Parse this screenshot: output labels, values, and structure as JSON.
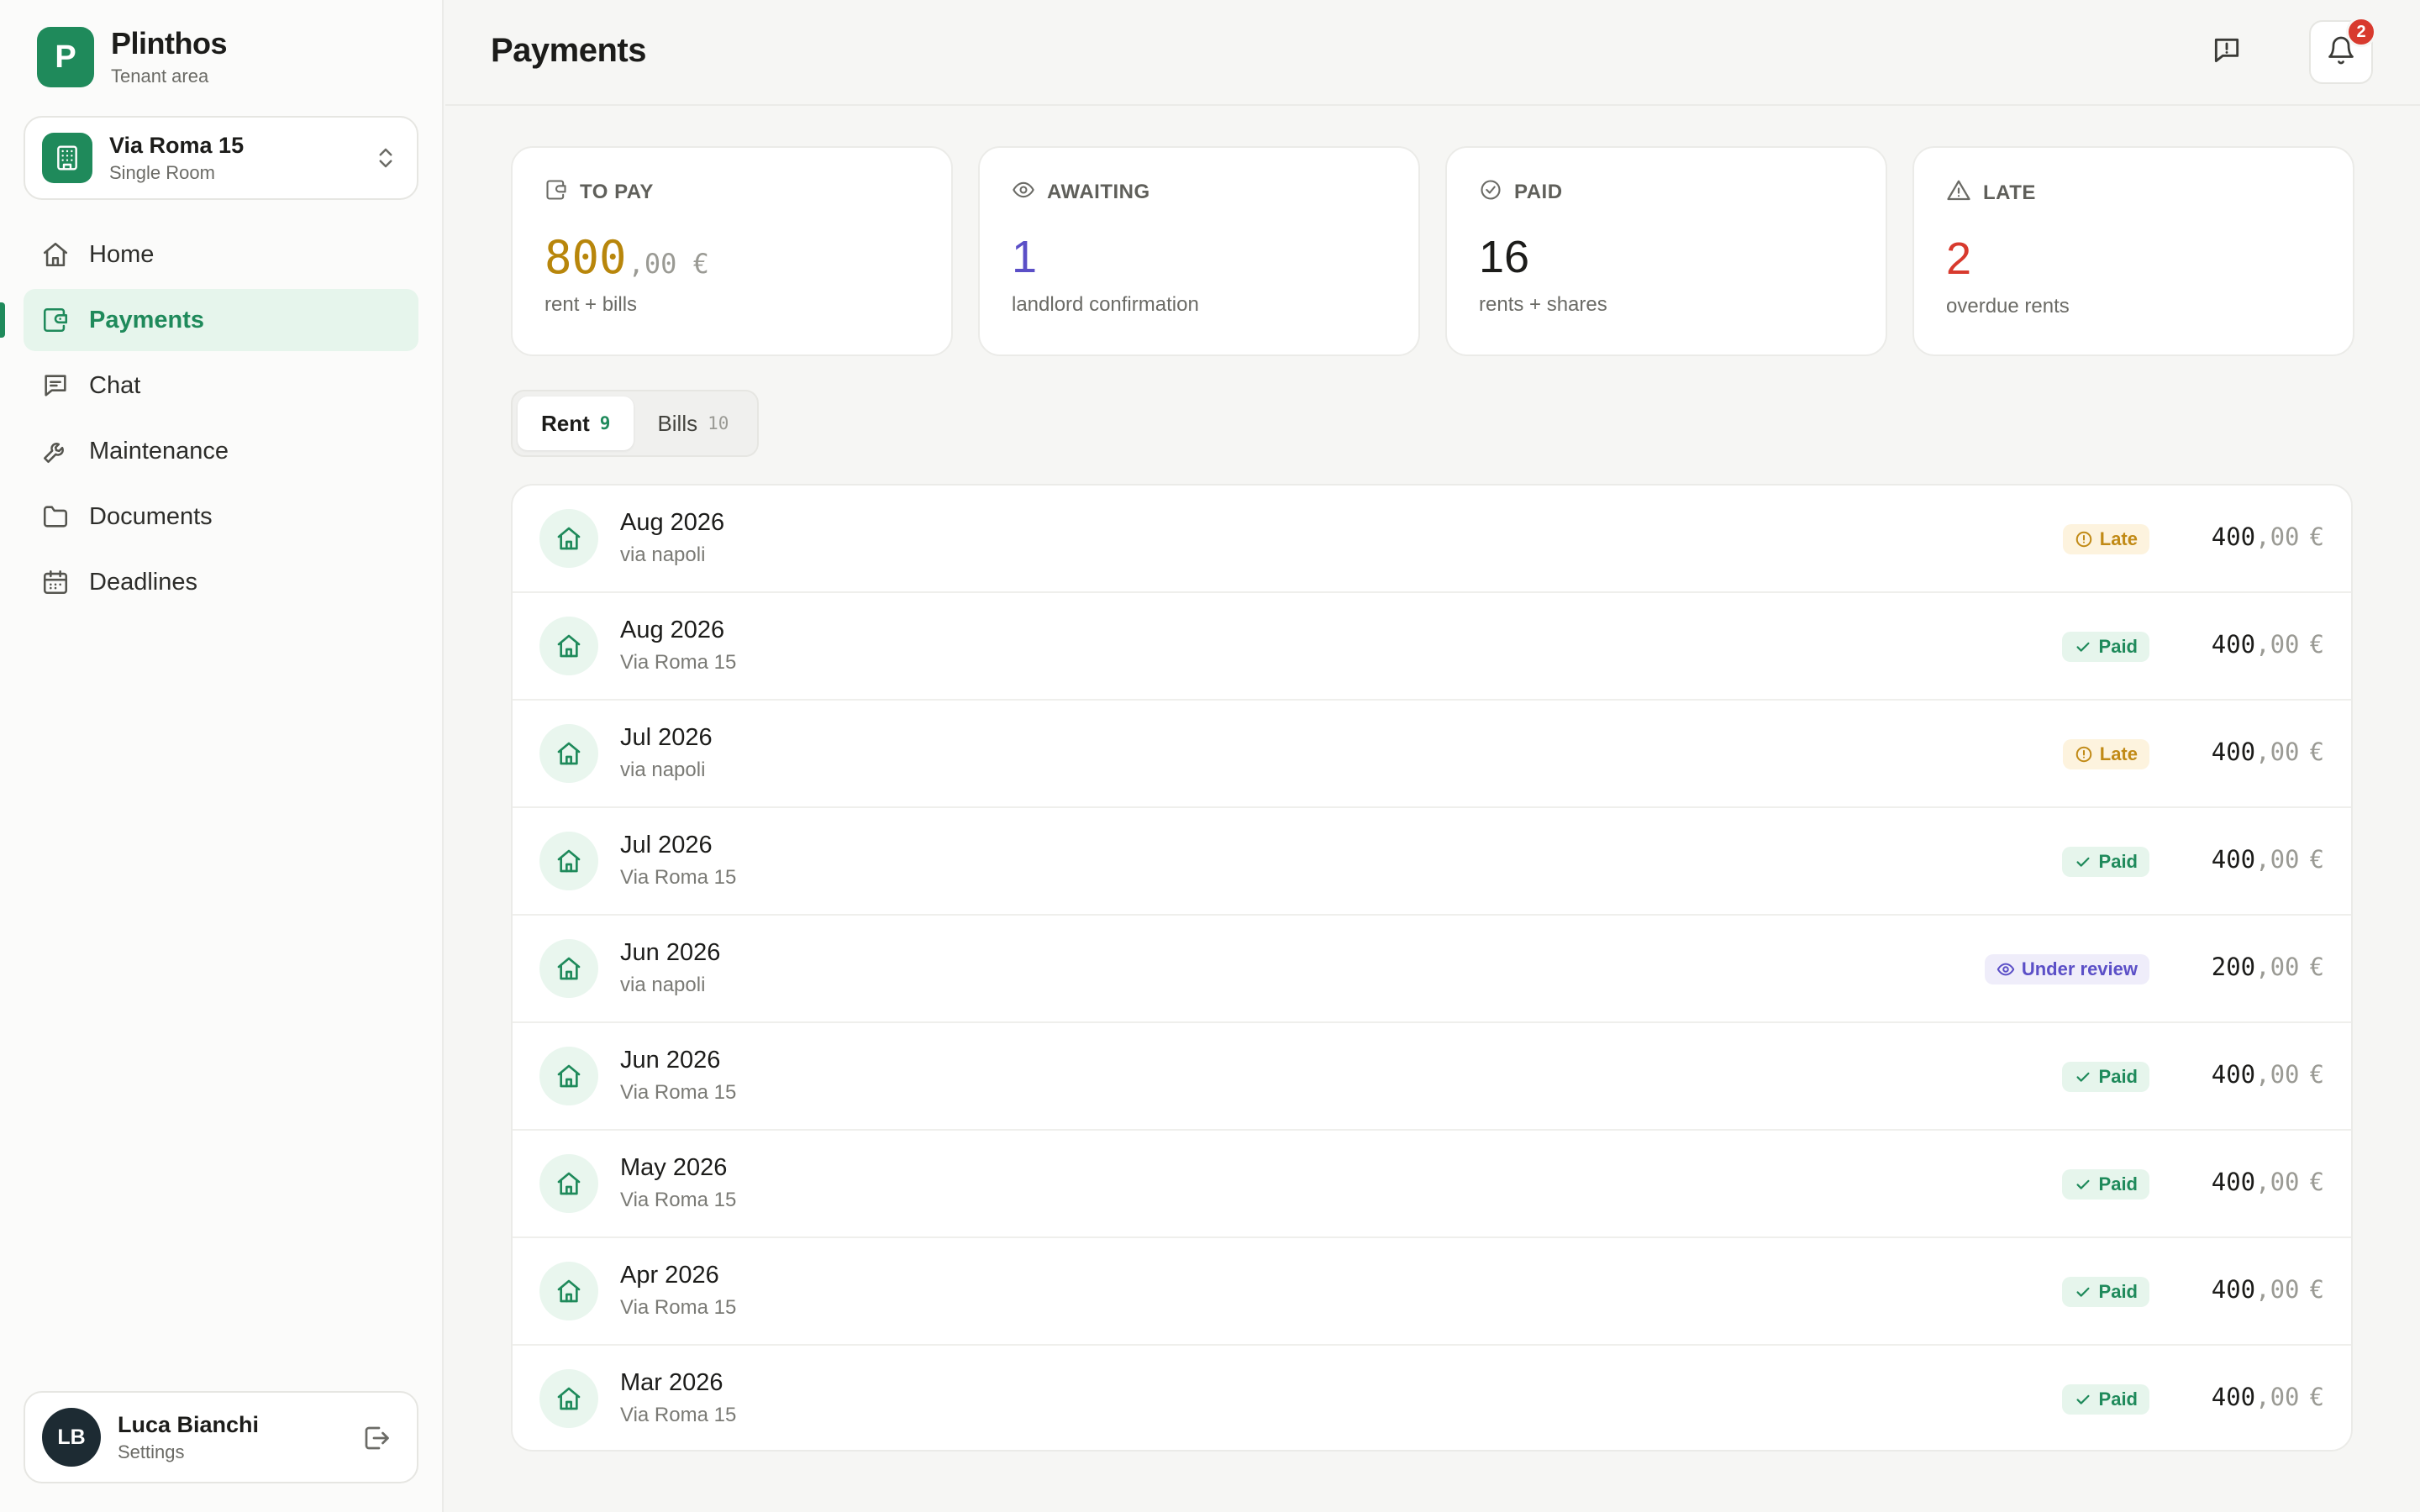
{
  "brand": {
    "logo_letter": "P",
    "name": "Plinthos",
    "subtitle": "Tenant area",
    "color": "#1f8a5b"
  },
  "property": {
    "name": "Via Roma 15",
    "type": "Single Room"
  },
  "nav": {
    "items": [
      {
        "label": "Home",
        "icon": "home-icon",
        "active": false
      },
      {
        "label": "Payments",
        "icon": "wallet-icon",
        "active": true
      },
      {
        "label": "Chat",
        "icon": "chat-icon",
        "active": false
      },
      {
        "label": "Maintenance",
        "icon": "wrench-icon",
        "active": false
      },
      {
        "label": "Documents",
        "icon": "folder-icon",
        "active": false
      },
      {
        "label": "Deadlines",
        "icon": "calendar-icon",
        "active": false
      }
    ]
  },
  "user": {
    "initials": "LB",
    "name": "Luca Bianchi",
    "subtitle": "Settings"
  },
  "header": {
    "title": "Payments",
    "notifications": "2"
  },
  "stats": [
    {
      "label": "TO PAY",
      "icon": "wallet-icon",
      "value": "800",
      "decimals": ",00 €",
      "subtitle": "rent + bills",
      "color": "#b8860b"
    },
    {
      "label": "AWAITING",
      "icon": "eye-icon",
      "value": "1",
      "decimals": "",
      "subtitle": "landlord confirmation",
      "color": "#5b4fc7"
    },
    {
      "label": "PAID",
      "icon": "check-circle-icon",
      "value": "16",
      "decimals": "",
      "subtitle": "rents + shares",
      "color": "#1c1c1a"
    },
    {
      "label": "LATE",
      "icon": "warning-icon",
      "value": "2",
      "decimals": "",
      "subtitle": "overdue rents",
      "color": "#d83a2e"
    }
  ],
  "tabs": [
    {
      "label": "Rent",
      "count": "9",
      "active": true
    },
    {
      "label": "Bills",
      "count": "10",
      "active": false
    }
  ],
  "payments": [
    {
      "month": "Aug 2026",
      "address": "via napoli",
      "status": "late",
      "status_label": "Late",
      "amount": "400",
      "decimals": ",00",
      "currency": "€"
    },
    {
      "month": "Aug 2026",
      "address": "Via Roma 15",
      "status": "paid",
      "status_label": "Paid",
      "amount": "400",
      "decimals": ",00",
      "currency": "€"
    },
    {
      "month": "Jul 2026",
      "address": "via napoli",
      "status": "late",
      "status_label": "Late",
      "amount": "400",
      "decimals": ",00",
      "currency": "€"
    },
    {
      "month": "Jul 2026",
      "address": "Via Roma 15",
      "status": "paid",
      "status_label": "Paid",
      "amount": "400",
      "decimals": ",00",
      "currency": "€"
    },
    {
      "month": "Jun 2026",
      "address": "via napoli",
      "status": "review",
      "status_label": "Under review",
      "amount": "200",
      "decimals": ",00",
      "currency": "€"
    },
    {
      "month": "Jun 2026",
      "address": "Via Roma 15",
      "status": "paid",
      "status_label": "Paid",
      "amount": "400",
      "decimals": ",00",
      "currency": "€"
    },
    {
      "month": "May 2026",
      "address": "Via Roma 15",
      "status": "paid",
      "status_label": "Paid",
      "amount": "400",
      "decimals": ",00",
      "currency": "€"
    },
    {
      "month": "Apr 2026",
      "address": "Via Roma 15",
      "status": "paid",
      "status_label": "Paid",
      "amount": "400",
      "decimals": ",00",
      "currency": "€"
    },
    {
      "month": "Mar 2026",
      "address": "Via Roma 15",
      "status": "paid",
      "status_label": "Paid",
      "amount": "400",
      "decimals": ",00",
      "currency": "€"
    }
  ]
}
